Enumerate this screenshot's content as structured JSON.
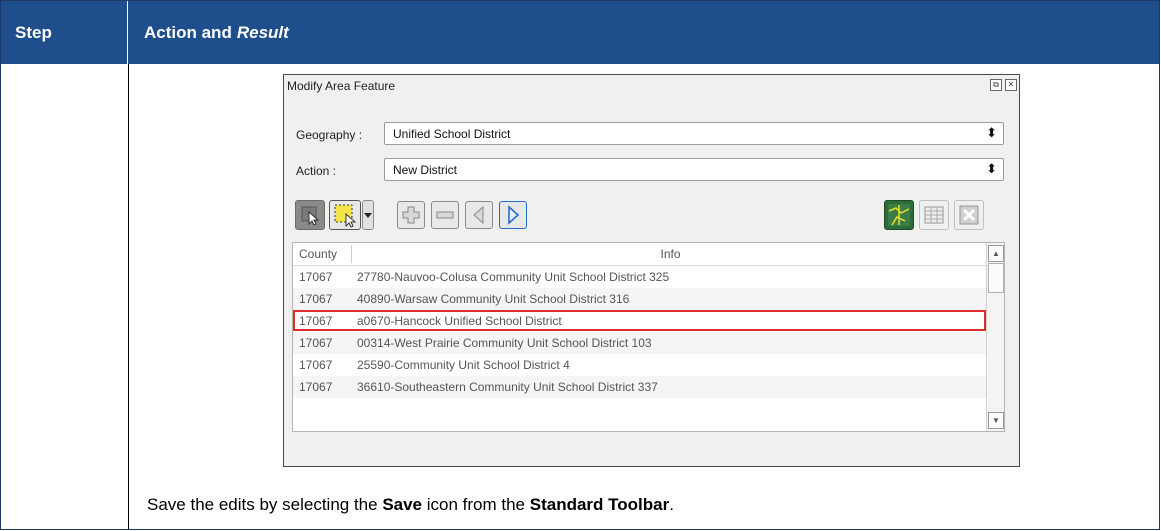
{
  "table": {
    "col_step": "Step",
    "col_action": "Action and",
    "col_action_italic": "Result"
  },
  "dialog": {
    "title": "Modify Area Feature",
    "geography_label": "Geography :",
    "geography_value": "Unified School District",
    "action_label": "Action :",
    "action_value": "New District",
    "list": {
      "col_county": "County",
      "col_info": "Info",
      "rows": [
        {
          "county": "17067",
          "info": "27780-Nauvoo-Colusa Community Unit School District 325"
        },
        {
          "county": "17067",
          "info": "40890-Warsaw Community Unit School District 316"
        },
        {
          "county": "17067",
          "info": "a0670-Hancock Unified School District",
          "selected": true
        },
        {
          "county": "17067",
          "info": "00314-West Prairie Community Unit School District 103"
        },
        {
          "county": "17067",
          "info": "25590-Community Unit School District 4"
        },
        {
          "county": "17067",
          "info": "36610-Southeastern Community Unit School District 337"
        }
      ]
    },
    "icons": [
      "select-feature-icon",
      "rectangle-select-icon",
      "dropdown-arrow-icon",
      "add-icon",
      "remove-icon",
      "previous-icon",
      "next-icon",
      "map-view-icon",
      "attribute-table-icon",
      "clear-icon"
    ]
  },
  "result": {
    "pre": "Save the edits by selecting the ",
    "bold1": "Save",
    "mid": " icon from the ",
    "bold2": "Standard Toolbar",
    "post": "."
  },
  "colors": {
    "header_bg": "#1f4e8c",
    "highlight": "#e02b2b",
    "next_arrow": "#1f6fd1"
  }
}
